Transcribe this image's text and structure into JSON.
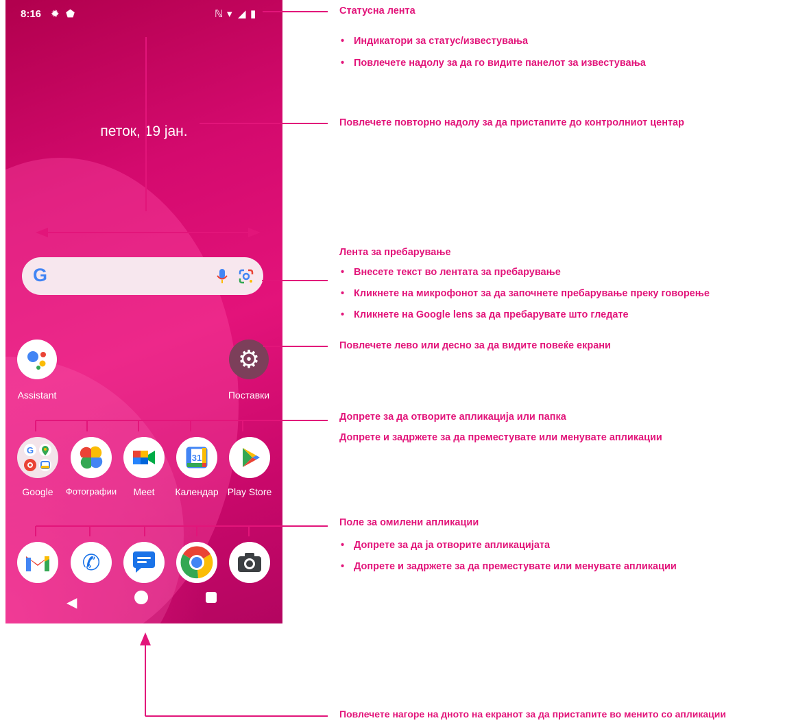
{
  "status_bar": {
    "time": "8:16"
  },
  "home": {
    "date": "петок, 19 јан.",
    "search_logo": "G",
    "assistant_label": "Assistant",
    "settings_label": "Поставки",
    "apps": [
      {
        "label": "Google"
      },
      {
        "label": "Фотографии"
      },
      {
        "label": "Meet"
      },
      {
        "label": "Календар",
        "icon_text": "31"
      },
      {
        "label": "Play Store"
      }
    ]
  },
  "annotations": {
    "status_title": "Статусна лента",
    "status_b1": "Индикатори за статус/известувања",
    "status_b2": "Повлечете надолу за да го видите панелот за известувања",
    "control": "Повлечете повторно надолу за да пристапите до контролниот центар",
    "search_title": "Лента за пребарување",
    "search_b1": "Внесете текст во лентата за пребарување",
    "search_b2": "Кликнете на микрофонот за да започнете пребарување преку говорење",
    "search_b3": "Кликнете на Google lens за да пребарувате што гледате",
    "screens": "Повлечете лево или десно за да видите повеќе екрани",
    "apps_line1": "Допрете за да отворите апликација или папка",
    "apps_line2": "Допрете и задржете за да преместувате или менувате апликации",
    "fav_title": "Поле за омилени апликации",
    "fav_b1": "Допрете за да ја отворите апликацијата",
    "fav_b2": "Допрете и задржете за да преместувате или менувате апликации",
    "bottom": "Повлечете нагоре на дното на екранот за да пристапите во менито со апликации"
  },
  "bullet": "•",
  "colors": {
    "accent": "#e2157a",
    "wallpaper": "#d40a6e"
  }
}
